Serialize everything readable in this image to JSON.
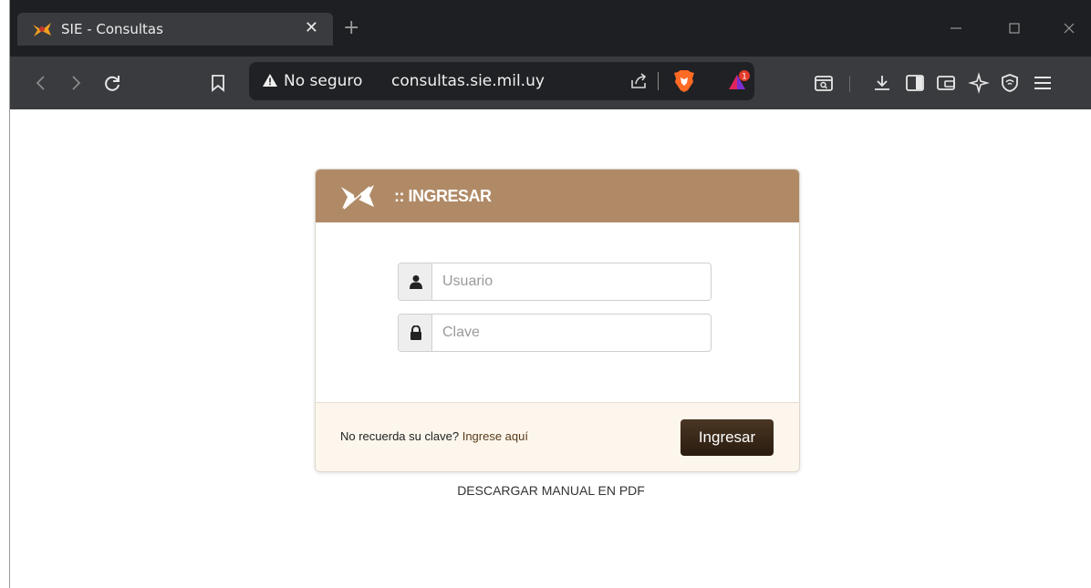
{
  "browser": {
    "tab": {
      "title": "SIE - Consultas",
      "close_glyph": "✕"
    },
    "new_tab_glyph": "+",
    "address": {
      "security_label": "No seguro",
      "url": "consultas.sie.mil.uy"
    },
    "icons": [
      "back-icon",
      "forward-icon",
      "reload-icon",
      "bookmark-icon",
      "warning-icon",
      "share-icon",
      "brave-shields-icon",
      "brave-rewards-icon",
      "reader-mode-icon",
      "downloads-icon",
      "sidebar-icon",
      "wallet-icon",
      "leo-ai-icon",
      "vpn-icon",
      "menu-icon",
      "minimize-icon",
      "maximize-icon",
      "close-window-icon"
    ],
    "rewards_badge": "1"
  },
  "login": {
    "title": ":: INGRESAR",
    "username_placeholder": "Usuario",
    "password_placeholder": "Clave",
    "forgot_prefix": "No recuerda su clave?",
    "forgot_link": "Ingrese aquí",
    "submit_label": "Ingresar",
    "header_color": "#b08a66",
    "button_color": "#3a2a1a"
  },
  "manual_link": "DESCARGAR MANUAL EN PDF"
}
